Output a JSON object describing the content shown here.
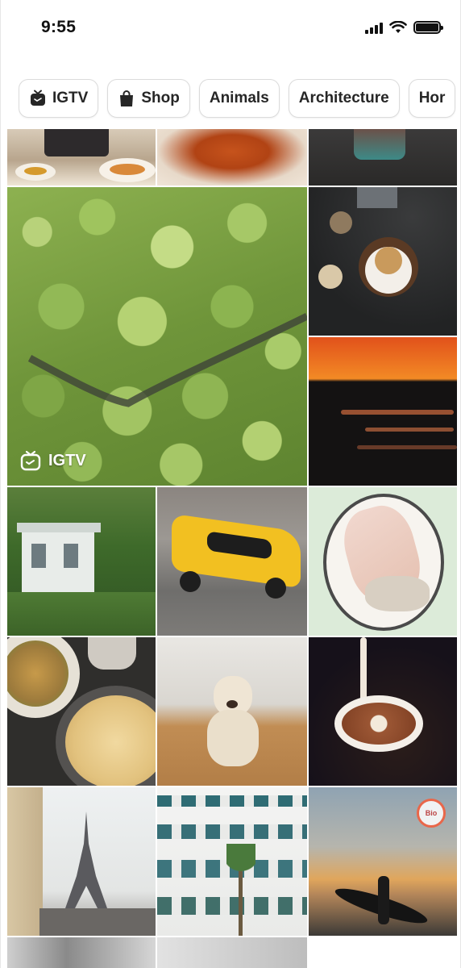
{
  "status": {
    "time": "9:55"
  },
  "chips": [
    {
      "label": "IGTV",
      "icon": "igtv-icon"
    },
    {
      "label": "Shop",
      "icon": "shopping-bag-icon"
    },
    {
      "label": "Animals"
    },
    {
      "label": "Architecture"
    },
    {
      "label": "Hor"
    }
  ],
  "grid": {
    "igtv_badge_label": "IGTV",
    "shop_badge_label": "Bio",
    "tiles": [
      "food-plates-photo",
      "spaghetti-photo",
      "coffee-cup-photo",
      "aerial-forest-video",
      "dessert-table-photo",
      "sunset-lake-photo",
      "house-garden-photo",
      "yellow-muscle-car-photo",
      "plated-dish-photo",
      "noodle-bowl-photo",
      "labrador-dog-photo",
      "latte-art-photo",
      "eiffel-tower-photo",
      "modern-building-photo",
      "surfer-sunset-photo"
    ]
  },
  "colors": {
    "chip_border": "#dbdbdb",
    "shop_ring": "#e9674a",
    "text": "#262626"
  }
}
